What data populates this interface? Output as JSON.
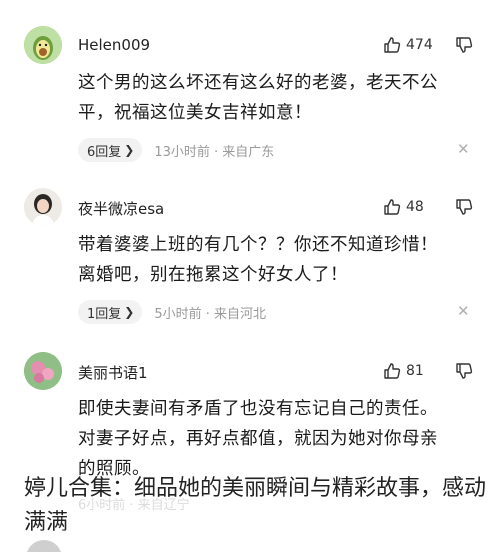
{
  "comments": [
    {
      "username": "Helen009",
      "likes": "474",
      "text_line1": "这个男的这么坏还有这么好的老婆，老天不公",
      "text_line2": "平，祝福这位美女吉祥如意！",
      "reply_label": "6回复",
      "meta": "13小时前 · 来自广东"
    },
    {
      "username": "夜半微凉esa",
      "likes": "48",
      "text_line1": "带着婆婆上班的有几个？？你还不知道珍惜！",
      "text_line2": "离婚吧，别在拖累这个好女人了！",
      "reply_label": "1回复",
      "meta": "5小时前 · 来自河北"
    },
    {
      "username": "美丽书语1",
      "likes": "81",
      "text_line1": "即使夫妻间有矛盾了也没有忘记自己的责任。",
      "text_line2": "对妻子好点，再好点都值，就因为她对你母亲",
      "text_line3": "的照顾。"
    }
  ],
  "overlay": {
    "caption": "婷儿合集：细品她的美丽瞬间与精彩故事，感动满满",
    "faded_meta": "6小时前 · 来自辽宁"
  },
  "icons": {
    "like": "thumbs-up-icon",
    "dislike": "thumbs-down-icon",
    "close": "close-icon",
    "chevron": "chevron-right-icon"
  }
}
